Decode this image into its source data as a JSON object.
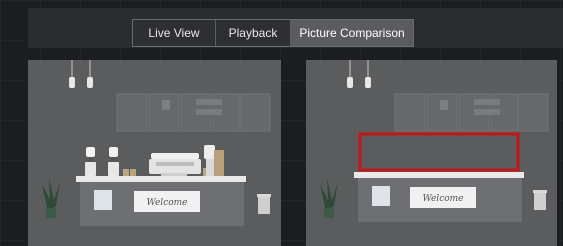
{
  "tabs": [
    {
      "label": "Live View",
      "active": false
    },
    {
      "label": "Playback",
      "active": false
    },
    {
      "label": "Picture Comparison",
      "active": true
    }
  ],
  "scene_left": {
    "sign_text": "Welcome",
    "icons": [
      "pendant-lamp",
      "wall-cabinet",
      "coffee-grinder",
      "espresso-machine",
      "coffee-cup",
      "plant",
      "trash-bin"
    ]
  },
  "scene_right": {
    "sign_text": "Welcome",
    "highlight_color": "#c0161a",
    "icons": [
      "pendant-lamp",
      "wall-cabinet",
      "plant",
      "trash-bin"
    ]
  },
  "colors": {
    "background": "#1c1d20",
    "toolbar": "#2b2c2f",
    "active_tab": "#5b5c60",
    "scene_wall": "#5b5c5e",
    "counter_top": "#e9e9ea",
    "counter_front": "#6e6f72"
  }
}
